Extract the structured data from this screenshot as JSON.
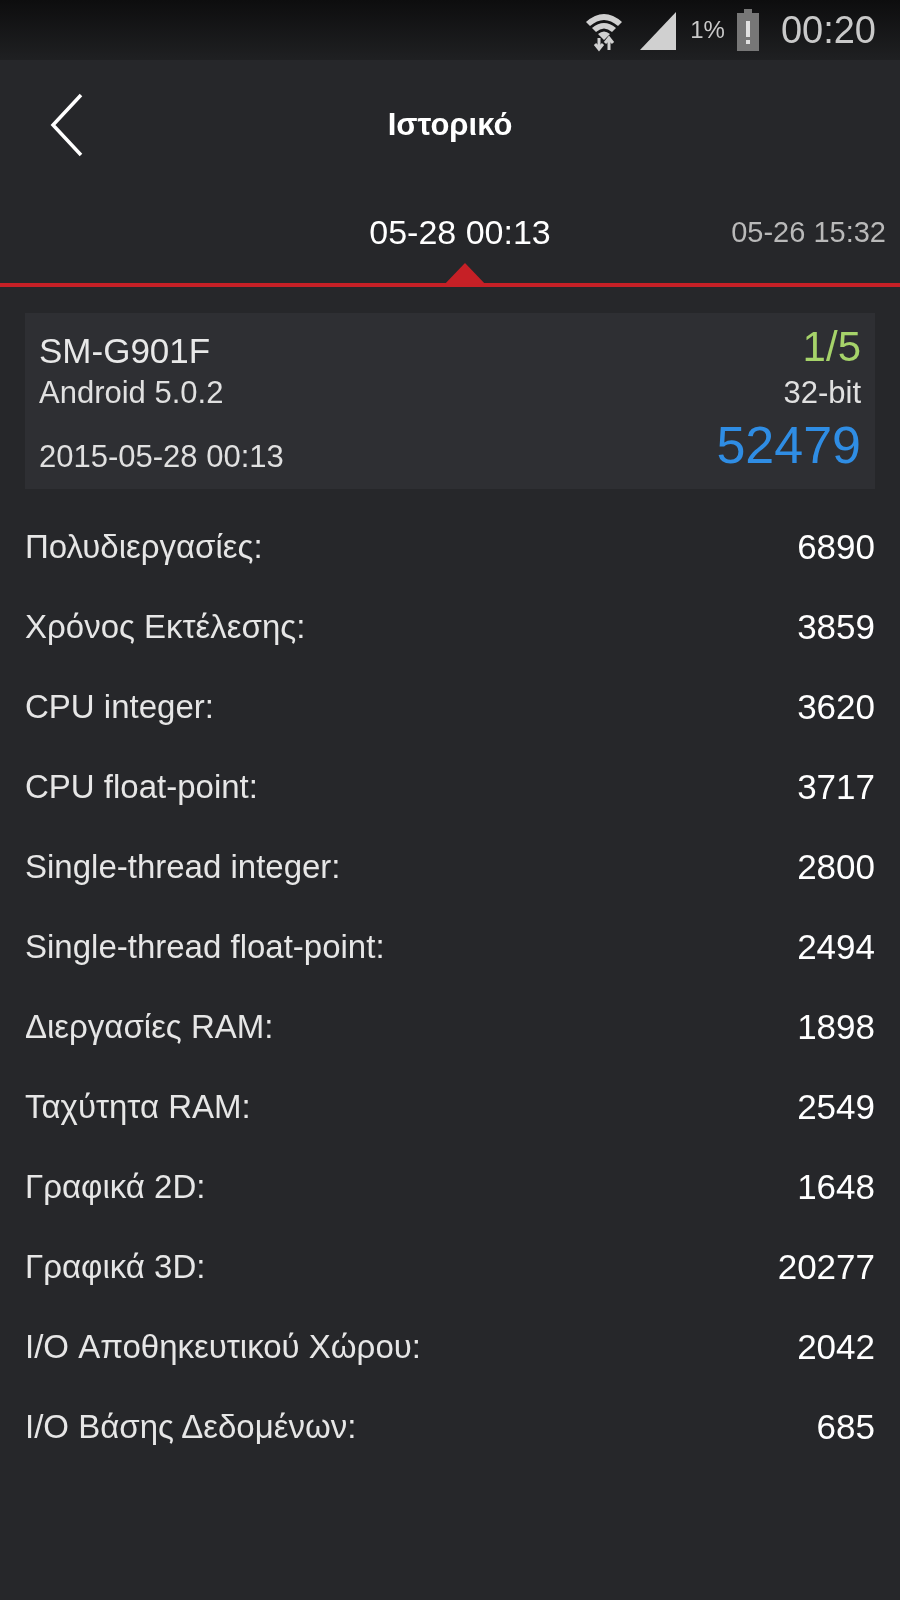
{
  "status_bar": {
    "battery": "1%",
    "time": "00:20"
  },
  "header": {
    "title": "Ιστορικό"
  },
  "tabs": [
    {
      "label": "05-28 00:13",
      "selected": true
    },
    {
      "label": "05-26 15:32",
      "selected": false
    }
  ],
  "card": {
    "model": "SM-G901F",
    "rank": "1/5",
    "os": "Android 5.0.2",
    "arch": "32-bit",
    "date": "2015-05-28 00:13",
    "score": "52479"
  },
  "results": [
    {
      "label": "Πολυδιεργασίες:",
      "value": "6890"
    },
    {
      "label": "Χρόνος Εκτέλεσης:",
      "value": "3859"
    },
    {
      "label": "CPU integer:",
      "value": "3620"
    },
    {
      "label": "CPU float-point:",
      "value": "3717"
    },
    {
      "label": "Single-thread integer:",
      "value": "2800"
    },
    {
      "label": "Single-thread float-point:",
      "value": "2494"
    },
    {
      "label": "Διεργασίες RAM:",
      "value": "1898"
    },
    {
      "label": "Ταχύτητα RAM:",
      "value": "2549"
    },
    {
      "label": "Γραφικά 2D:",
      "value": "1648"
    },
    {
      "label": "Γραφικά 3D:",
      "value": "20277"
    },
    {
      "label": "I/O Αποθηκευτικού Χώρου:",
      "value": "2042"
    },
    {
      "label": "I/O Βάσης Δεδομένων:",
      "value": "685"
    }
  ]
}
